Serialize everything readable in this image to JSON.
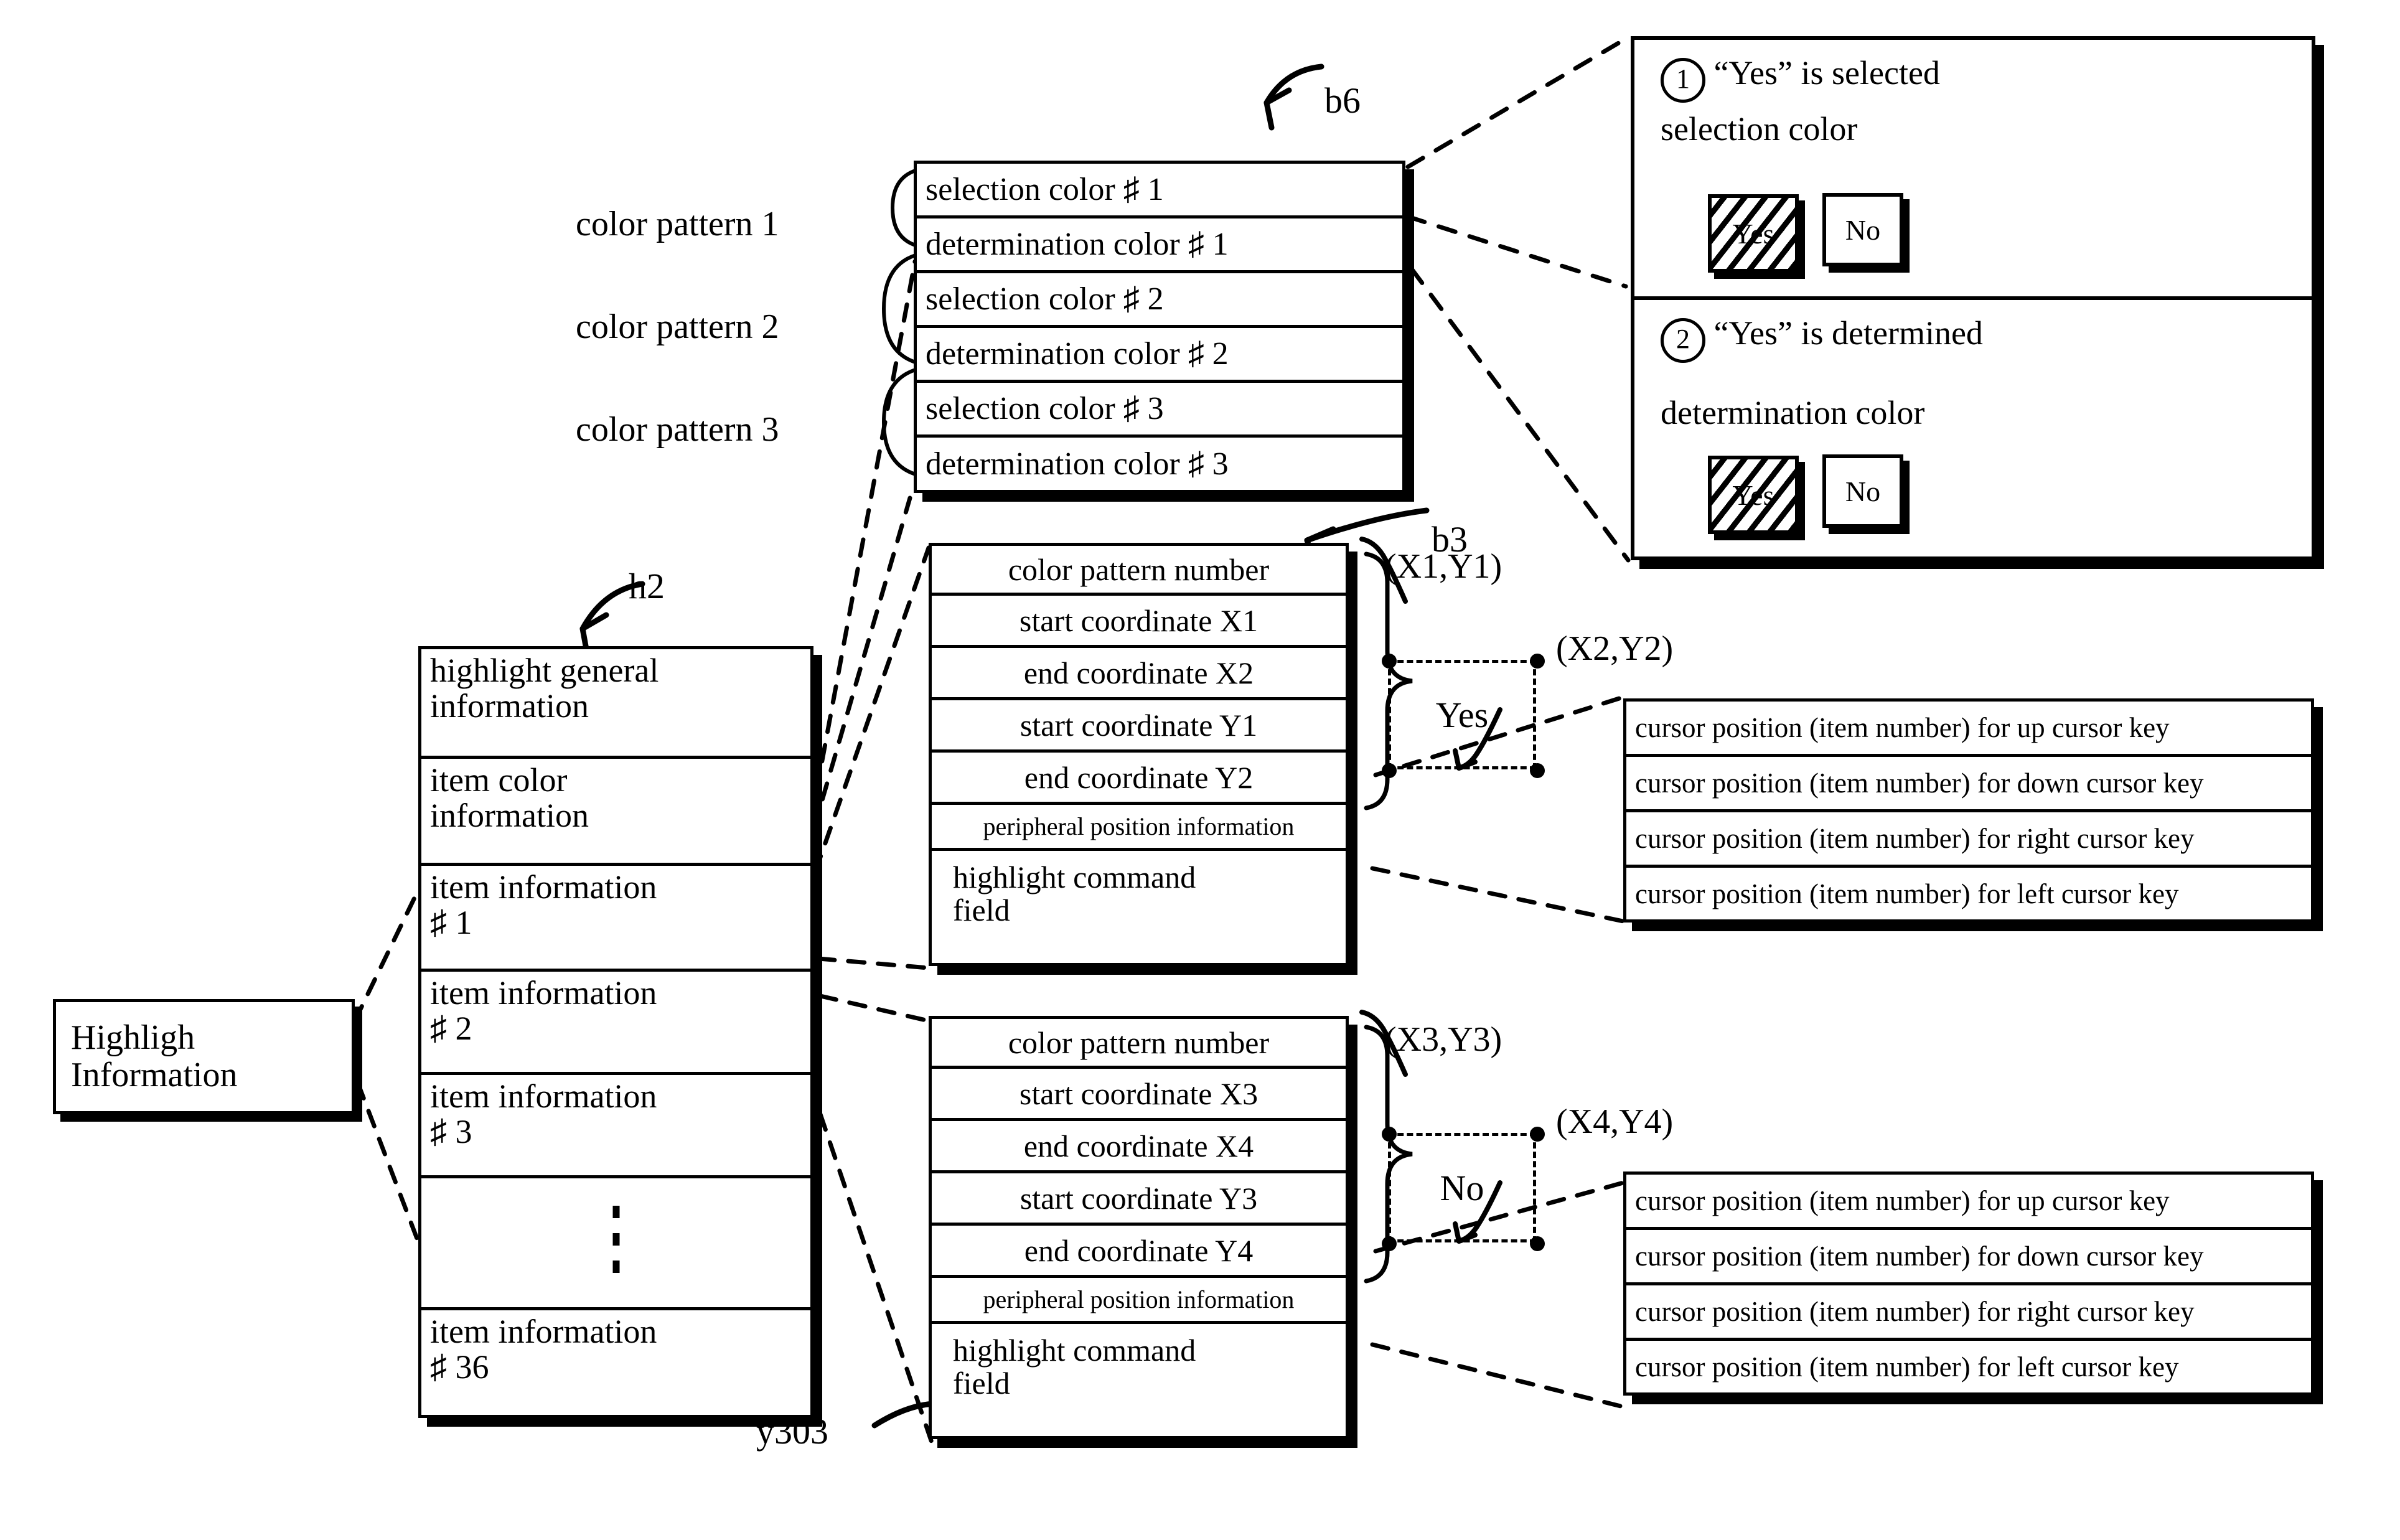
{
  "figure": {
    "kind": "patent-data-structure-diagram",
    "refs": {
      "b6": "b6",
      "b3": "b3",
      "h2": "h2",
      "y303": "y303"
    }
  },
  "root_box": {
    "line1": "Highligh",
    "line2": "Information"
  },
  "color_pattern_labels": [
    "color pattern 1",
    "color pattern 2",
    "color pattern 3"
  ],
  "b6_table": {
    "ref": "b6",
    "rows": [
      "selection color ♯ 1",
      "determination color ♯ 1",
      "selection color ♯ 2",
      "determination color ♯ 2",
      "selection color ♯ 3",
      "determination color ♯ 3"
    ]
  },
  "h2_table": {
    "ref": "h2",
    "rows": [
      {
        "line1": "highlight general",
        "line2": "information"
      },
      {
        "line1": "item color",
        "line2": "information"
      },
      {
        "line1": "item information",
        "line2": "♯ 1"
      },
      {
        "line1": "item information",
        "line2": "♯ 2"
      },
      {
        "line1": "item information",
        "line2": "♯ 3"
      },
      {
        "line1": "",
        "line2": "",
        "ellipsis": true
      },
      {
        "line1": "item information",
        "line2": "♯ 36"
      }
    ]
  },
  "b3_table_top": {
    "ref": "b3",
    "rows": [
      "color pattern number",
      "start coordinate X1",
      "end coordinate X2",
      "start coordinate Y1",
      "end coordinate Y2",
      "peripheral position information"
    ],
    "last_row": {
      "line1": "highlight command",
      "line2": "field"
    }
  },
  "b3_table_bottom": {
    "ref": "y303",
    "rows": [
      "color pattern number",
      "start coordinate X3",
      "end coordinate X4",
      "start coordinate Y3",
      "end coordinate Y4",
      "peripheral position information"
    ],
    "last_row": {
      "line1": "highlight command",
      "line2": "field"
    }
  },
  "selection_yes": {
    "label": "Yes",
    "start_coord": "(X1,Y1)",
    "end_coord": "(X2,Y2)"
  },
  "selection_no": {
    "label": "No",
    "start_coord": "(X3,Y3)",
    "end_coord": "(X4,Y4)"
  },
  "cursor_table_top": {
    "rows": [
      "cursor position (item number) for up cursor key",
      "cursor position (item number) for down cursor key",
      "cursor position (item number) for right cursor key",
      "cursor position (item number) for left cursor key"
    ]
  },
  "cursor_table_bottom": {
    "rows": [
      "cursor position (item number) for up cursor key",
      "cursor position (item number) for down cursor key",
      "cursor position (item number) for right cursor key",
      "cursor position (item number) for left cursor key"
    ]
  },
  "explanation_panel": {
    "item1": {
      "number": "①",
      "number_plain": "1",
      "heading": "“Yes”  is selected",
      "caption": "selection color",
      "button_selected": "Yes",
      "button_other": "No"
    },
    "item2": {
      "number": "②",
      "number_plain": "2",
      "heading": "“Yes”   is determined",
      "caption": "determination color",
      "button_selected": "Yes",
      "button_other": "No"
    }
  },
  "colors": {
    "ink": "#000000",
    "paper": "#ffffff"
  }
}
